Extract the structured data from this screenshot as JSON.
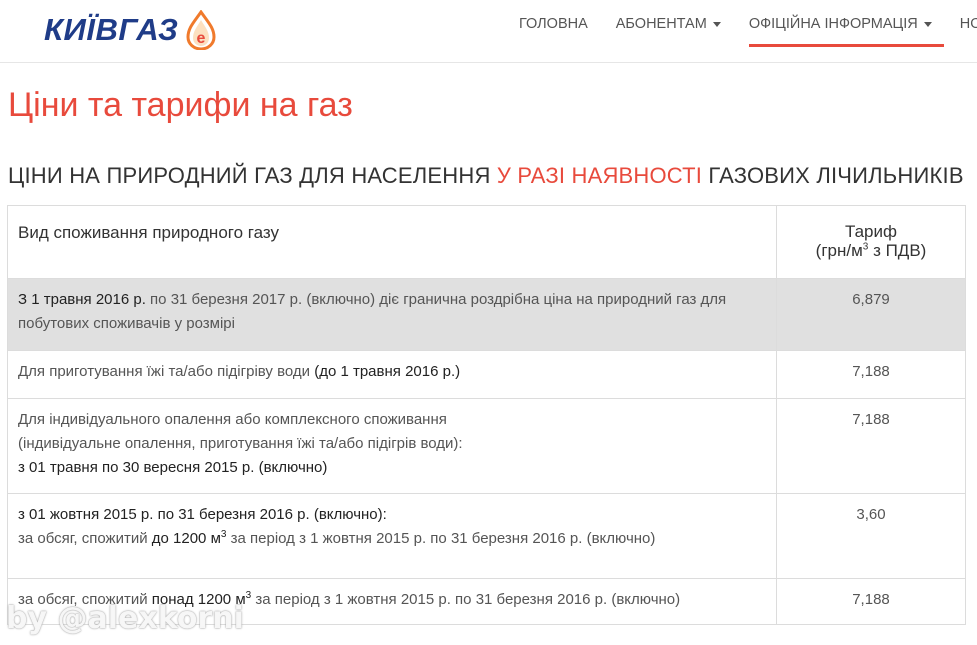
{
  "logo": {
    "text": "КИЇВГАЗ",
    "badge": "e",
    "brand_color": "#1f3c88",
    "accent_color": "#e84a3c"
  },
  "nav": {
    "items": [
      {
        "label": "ГОЛОВНА"
      },
      {
        "label": "АБОНЕНТАМ"
      },
      {
        "label": "ОФІЦІЙНА ІНФОРМАЦІЯ"
      },
      {
        "label": "НОВ"
      }
    ]
  },
  "page_title": "Ціни та тарифи на газ",
  "section": {
    "title_before": "ЦІНИ НА ПРИРОДНИЙ ГАЗ ДЛЯ НАСЕЛЕННЯ ",
    "title_highlight": "У РАЗІ НАЯВНОСТІ",
    "title_after": " ГАЗОВИХ ЛІЧИЛЬНИКІВ"
  },
  "table": {
    "col1_header": "Вид споживання природного газу",
    "col2_header_line1": "Тариф",
    "col2_header_line2a": "(грн/м",
    "col2_header_sup": "3",
    "col2_header_line2b": " з ПДВ)",
    "rows": [
      {
        "bold1": "З 1 травня 2016 р.",
        "text1": " по 31 березня 2017 р. (включно) діє гранична роздрібна ціна на природний газ для побутових споживачів у розмірі",
        "value": "6,879"
      },
      {
        "text1": "Для приготування їжі та/або підігріву води ",
        "bold1": "(до 1 травня 2016 р.)",
        "value": "7,188"
      },
      {
        "line1": "Для індивідуального опалення або комплексного споживання",
        "line2": "(індивідуальне опалення, приготування їжі та/або підігрів води):",
        "line3": "з 01 травня по 30 вересня 2015 р. (включно)",
        "value": "7,188"
      },
      {
        "line1": "з 01 жовтня 2015 р. по 31 березня 2016 р. (включно):",
        "text_a": "за обсяг, спожитий ",
        "bold_a": "до 1200 м",
        "sup": "3",
        "text_b": " за період з 1 жовтня 2015 р. по 31 березня 2016 р. (включно)",
        "value": "3,60"
      },
      {
        "text_a": "за обсяг, спожитий ",
        "bold_a": "понад 1200 м",
        "sup": "3",
        "text_b": " за період з 1 жовтня 2015 р. по 31 березня 2016 р. (включно)",
        "value": "7,188"
      }
    ]
  },
  "watermark": "by @alexkorni"
}
